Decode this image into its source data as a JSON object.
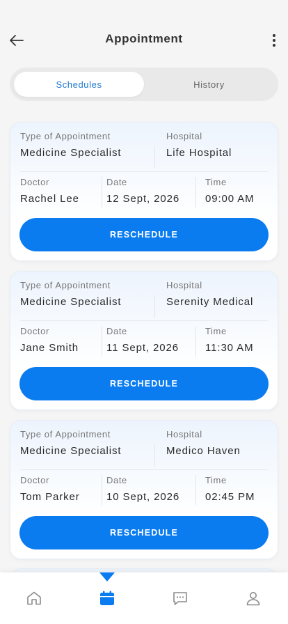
{
  "header": {
    "title": "Appointment"
  },
  "tabs": [
    {
      "label": "Schedules",
      "active": true
    },
    {
      "label": "History",
      "active": false
    }
  ],
  "appointments": [
    {
      "type_label": "Type of Appointment",
      "type_value": "Medicine Specialist",
      "hospital_label": "Hospital",
      "hospital_value": "Life Hospital",
      "doctor_label": "Doctor",
      "doctor_value": "Rachel Lee",
      "date_label": "Date",
      "date_value": "12 Sept, 2026",
      "time_label": "Time",
      "time_value": "09:00 AM",
      "button_label": "RESCHEDULE"
    },
    {
      "type_label": "Type of Appointment",
      "type_value": "Medicine Specialist",
      "hospital_label": "Hospital",
      "hospital_value": "Serenity Medical",
      "doctor_label": "Doctor",
      "doctor_value": "Jane Smith",
      "date_label": "Date",
      "date_value": "11 Sept, 2026",
      "time_label": "Time",
      "time_value": "11:30 AM",
      "button_label": "RESCHEDULE"
    },
    {
      "type_label": "Type of Appointment",
      "type_value": "Medicine Specialist",
      "hospital_label": "Hospital",
      "hospital_value": "Medico Haven",
      "doctor_label": "Doctor",
      "doctor_value": "Tom Parker",
      "date_label": "Date",
      "date_value": "10 Sept, 2026",
      "time_label": "Time",
      "time_value": "02:45 PM",
      "button_label": "RESCHEDULE"
    }
  ],
  "bottom_nav": {
    "items": [
      {
        "icon": "home-icon",
        "active": false
      },
      {
        "icon": "calendar-icon",
        "active": true
      },
      {
        "icon": "chat-icon",
        "active": false
      },
      {
        "icon": "profile-icon",
        "active": false
      }
    ]
  },
  "colors": {
    "accent": "#0a7cf0",
    "tab_active_text": "#1f78d1",
    "background": "#f5f5f5",
    "inactive_icon": "#8a8a8a"
  }
}
